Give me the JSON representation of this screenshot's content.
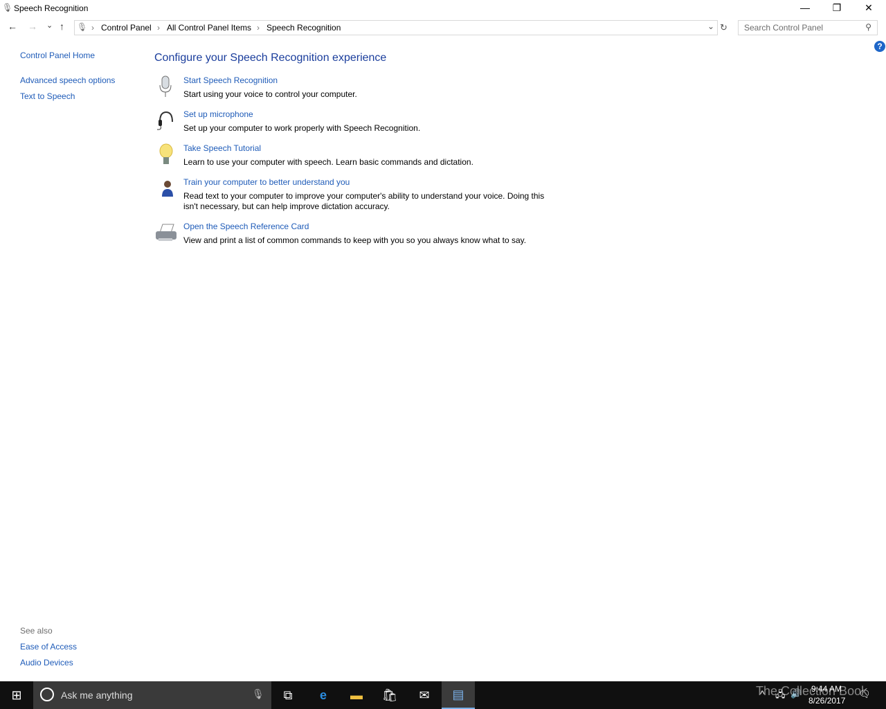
{
  "window": {
    "title": "Speech Recognition",
    "minimize": "—",
    "maximize": "❐",
    "close": "✕"
  },
  "nav": {
    "back": "←",
    "forward": "→",
    "recent": "⌄",
    "up": "↑",
    "dropdown": "⌄",
    "refresh": "↻"
  },
  "breadcrumb": [
    "Control Panel",
    "All Control Panel Items",
    "Speech Recognition"
  ],
  "search": {
    "placeholder": "Search Control Panel"
  },
  "help": "?",
  "sidebar": {
    "items": [
      "Control Panel Home",
      "Advanced speech options",
      "Text to Speech"
    ],
    "see_also_label": "See also",
    "see_also": [
      "Ease of Access",
      "Audio Devices"
    ]
  },
  "main": {
    "heading": "Configure your Speech Recognition experience",
    "tasks": [
      {
        "title": "Start Speech Recognition",
        "desc": "Start using your voice to control your computer.",
        "icon": "microphone-icon"
      },
      {
        "title": "Set up microphone",
        "desc": "Set up your computer to work properly with Speech Recognition.",
        "icon": "headset-icon"
      },
      {
        "title": "Take Speech Tutorial",
        "desc": "Learn to use your computer with speech.  Learn basic commands and dictation.",
        "icon": "lightbulb-icon"
      },
      {
        "title": "Train your computer to better understand you",
        "desc": "Read text to your computer to improve your computer's ability to understand your voice.  Doing this isn't necessary, but can help improve dictation accuracy.",
        "icon": "user-icon"
      },
      {
        "title": "Open the Speech Reference Card",
        "desc": "View and print a list of common commands to keep with you so you always know what to say.",
        "icon": "printer-icon"
      }
    ]
  },
  "taskbar": {
    "search_placeholder": "Ask me anything",
    "time": "9:44 AM",
    "date": "8/26/2017",
    "watermark": "The Collection Book"
  }
}
